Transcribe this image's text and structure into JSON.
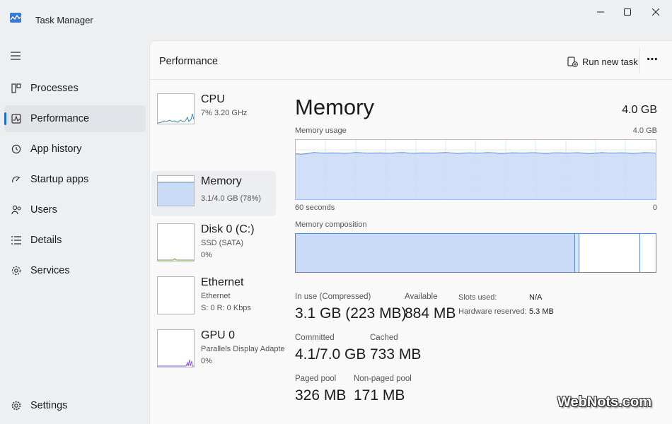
{
  "window": {
    "title": "Task Manager",
    "controls": [
      "minimize",
      "maximize",
      "close"
    ]
  },
  "nav": {
    "items": [
      {
        "label": "Processes",
        "icon": "processes-icon"
      },
      {
        "label": "Performance",
        "icon": "performance-icon",
        "active": true
      },
      {
        "label": "App history",
        "icon": "app-history-icon"
      },
      {
        "label": "Startup apps",
        "icon": "startup-apps-icon"
      },
      {
        "label": "Users",
        "icon": "users-icon"
      },
      {
        "label": "Details",
        "icon": "details-icon"
      },
      {
        "label": "Services",
        "icon": "services-icon"
      }
    ],
    "settings": "Settings"
  },
  "header": {
    "title": "Performance",
    "run_new_task": "Run new task",
    "more": "⋯"
  },
  "devices": [
    {
      "name": "CPU",
      "line1": "7%  3.20 GHz",
      "line2": ""
    },
    {
      "name": "Memory",
      "line1": "3.1/4.0 GB (78%)",
      "line2": "",
      "active": true
    },
    {
      "name": "Disk 0 (C:)",
      "line1": "SSD (SATA)",
      "line2": "0%"
    },
    {
      "name": "Ethernet",
      "line1": "Ethernet",
      "line2": "S: 0  R: 0 Kbps"
    },
    {
      "name": "GPU 0",
      "line1": "Parallels Display Adapte",
      "line2": "0%"
    }
  ],
  "memory": {
    "title": "Memory",
    "total": "4.0 GB",
    "usage_label": "Memory usage",
    "usage_max": "4.0 GB",
    "time_span": "60 seconds",
    "axis_zero": "0",
    "composition_label": "Memory composition",
    "composition_fractions": {
      "in_use": 0.776,
      "modified": 0.012,
      "standby": 0.168,
      "free": 0.044
    },
    "usage_fraction": 0.78,
    "stats": {
      "in_use_label": "In use (Compressed)",
      "in_use_value": "3.1 GB (223 MB)",
      "available_label": "Available",
      "available_value": "884 MB",
      "committed_label": "Committed",
      "committed_value": "4.1/7.0 GB",
      "cached_label": "Cached",
      "cached_value": "733 MB",
      "paged_label": "Paged pool",
      "paged_value": "326 MB",
      "nonpaged_label": "Non-paged pool",
      "nonpaged_value": "171 MB"
    },
    "info": {
      "slots_label": "Slots used:",
      "slots_value": "N/A",
      "reserved_label": "Hardware reserved:",
      "reserved_value": "5.3 MB"
    }
  },
  "colors": {
    "accent": "#1f6fd1",
    "memory_fill": "#c9dbf7",
    "memory_line": "#5b86c9",
    "cpu_line": "#3a87b0",
    "gpu_line": "#8a58d6"
  },
  "watermark": "WebNots.com"
}
